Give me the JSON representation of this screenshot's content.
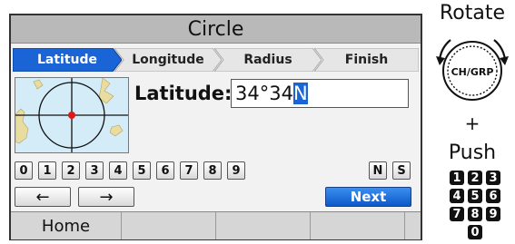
{
  "screen": {
    "title": "Circle",
    "steps": [
      "Latitude",
      "Longitude",
      "Radius",
      "Finish"
    ],
    "active_step": "Latitude",
    "field_label": "Latitude:",
    "field_value": "34°34",
    "field_cursor_char": "N",
    "keypad_keys": [
      "0",
      "1",
      "2",
      "3",
      "4",
      "5",
      "6",
      "7",
      "8",
      "9",
      "N",
      "S"
    ],
    "left_arrow": "←",
    "right_arrow": "→",
    "next_label": "Next",
    "softkeys": [
      "Home",
      "",
      "",
      ""
    ]
  },
  "side": {
    "rotate_label": "Rotate",
    "knob_label": "CH/GRP",
    "plus": "+",
    "push_label": "Push",
    "numpad": [
      "1",
      "2",
      "3",
      "4",
      "5",
      "6",
      "7",
      "8",
      "9",
      "0"
    ]
  },
  "colors": {
    "active_tab": "#1a64d6",
    "title_bar": "#b9b9b9",
    "next_button": "#0d58c8"
  },
  "icons": [
    "rotate-left-arrow-icon",
    "rotate-right-arrow-icon",
    "map-circle-icon"
  ]
}
